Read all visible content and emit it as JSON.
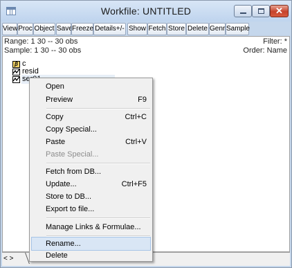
{
  "window": {
    "title": "Workfile: UNTITLED",
    "icon": "workfile-icon",
    "controls": [
      "minimize-icon",
      "maximize-icon",
      "close-icon"
    ],
    "close_glyph": "✕",
    "accent_close": "#c6422b"
  },
  "toolbar": {
    "buttons": [
      "View",
      "Proc",
      "Object",
      "Save",
      "Freeze",
      "Details+/-",
      "Show",
      "Fetch",
      "Store",
      "Delete",
      "Genr",
      "Sample"
    ]
  },
  "info": {
    "range": "Range:  1 30  --  30 obs",
    "sample": "Sample: 1 30  --  30 obs",
    "filter": "Filter: *",
    "order": "Order: Name"
  },
  "objects": [
    {
      "name": "c",
      "icon": "coefficient-icon",
      "glyph": "β"
    },
    {
      "name": "resid",
      "icon": "series-icon"
    },
    {
      "name": "ser01",
      "icon": "series-icon",
      "selected": true
    }
  ],
  "tabs": {
    "nav": "< >"
  },
  "context_menu": {
    "items": [
      {
        "label": "Open",
        "shortcut": ""
      },
      {
        "label": "Preview",
        "shortcut": "F9"
      },
      {
        "label": "Copy",
        "shortcut": "Ctrl+C"
      },
      {
        "label": "Copy Special...",
        "shortcut": ""
      },
      {
        "label": "Paste",
        "shortcut": "Ctrl+V"
      },
      {
        "label": "Paste Special...",
        "shortcut": "",
        "disabled": true
      },
      {
        "label": "Fetch from DB...",
        "shortcut": ""
      },
      {
        "label": "Update...",
        "shortcut": "Ctrl+F5"
      },
      {
        "label": "Store to DB...",
        "shortcut": ""
      },
      {
        "label": "Export to file...",
        "shortcut": ""
      },
      {
        "label": "Manage Links & Formulae...",
        "shortcut": ""
      },
      {
        "label": "Rename...",
        "shortcut": "",
        "highlighted": true
      },
      {
        "label": "Delete",
        "shortcut": ""
      }
    ]
  }
}
